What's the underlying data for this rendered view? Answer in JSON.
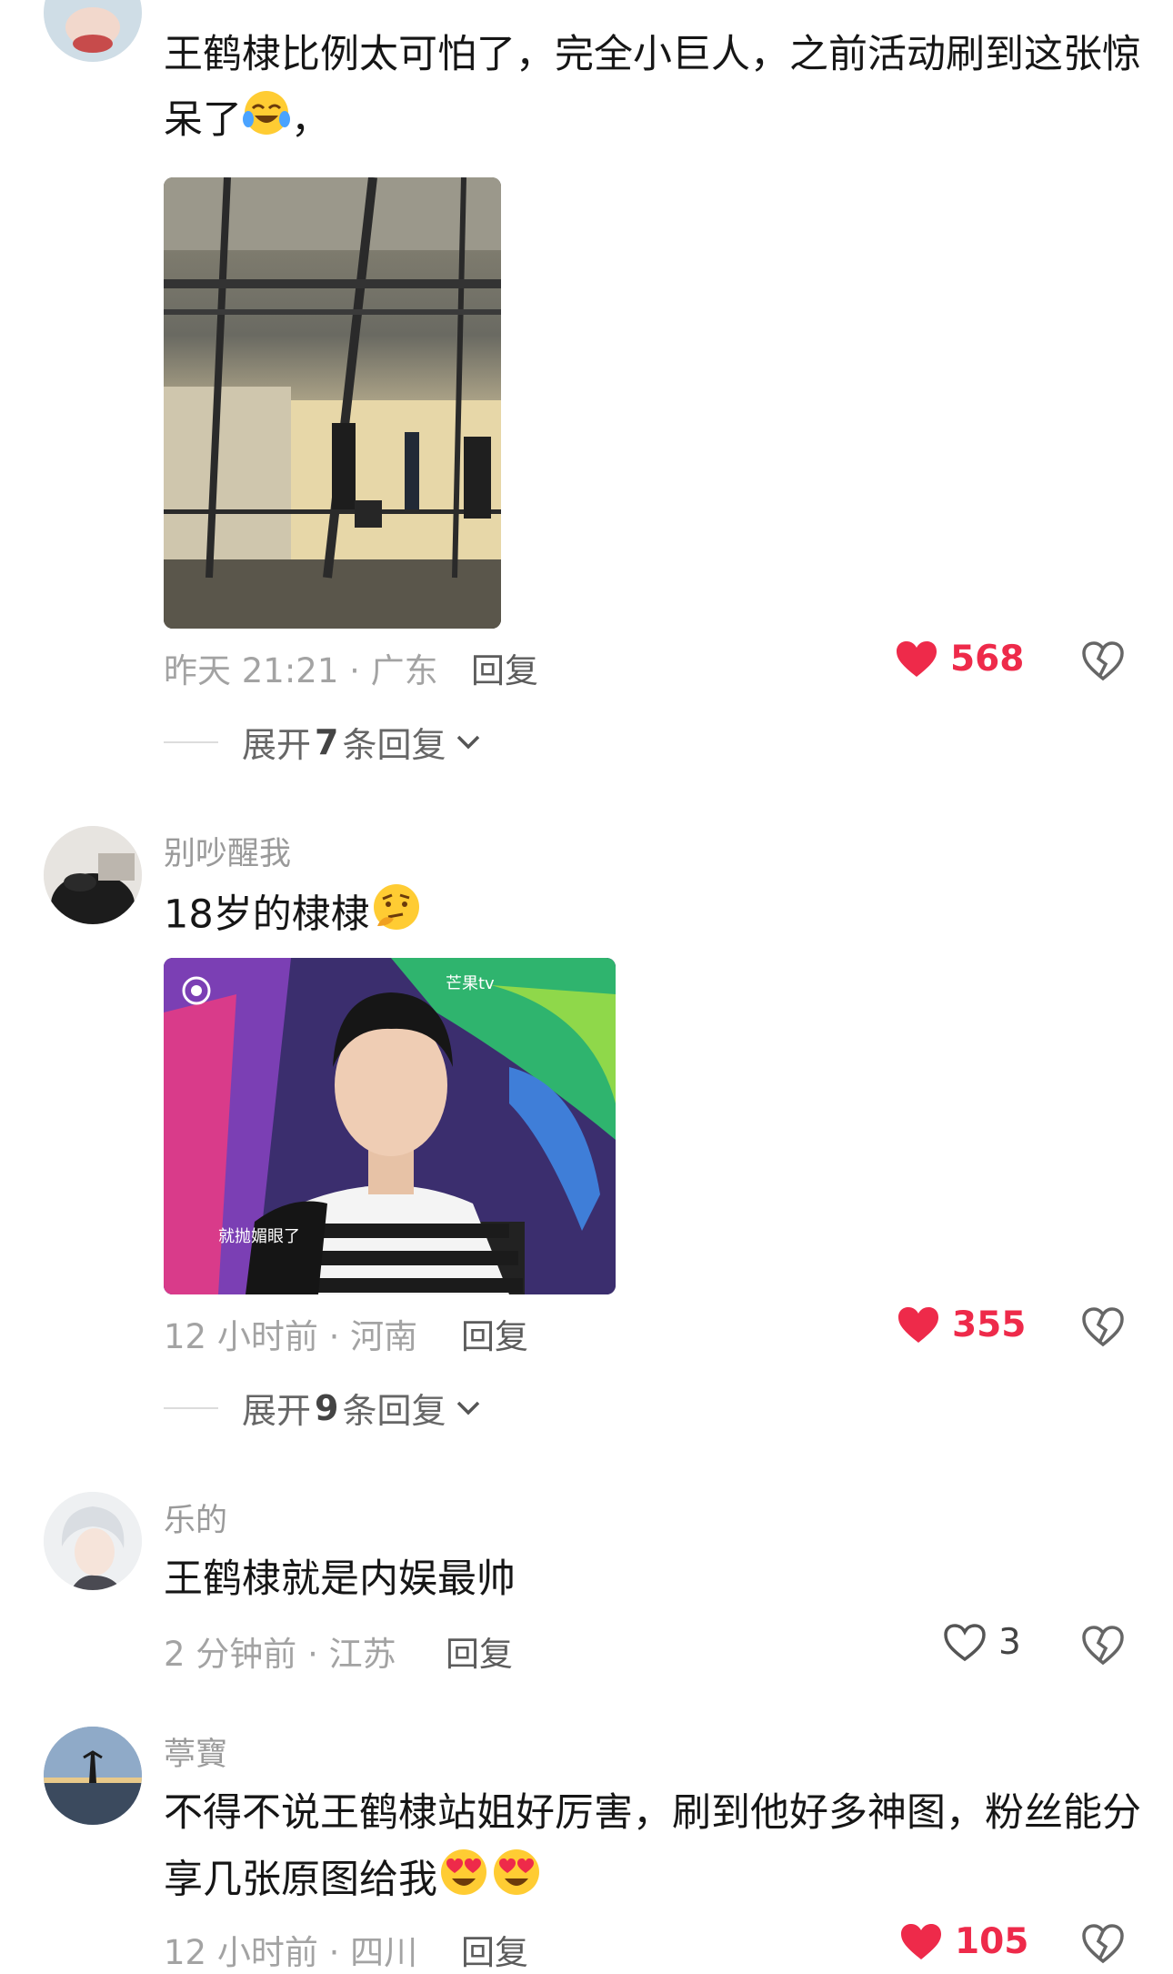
{
  "comments": [
    {
      "text": "王鹤棣比例太可怕了，完全小巨人，之前活动刷到这张惊呆了",
      "text_suffix": "，",
      "time_loc": "昨天 21:21 · 广东",
      "reply": "回复",
      "likes": "568",
      "liked": true,
      "expand": {
        "prefix": "展开",
        "count": "7",
        "suffix": "条回复"
      }
    },
    {
      "username": "别吵醒我",
      "text": "18岁的棣棣",
      "time_loc": "12 小时前 · 河南",
      "reply": "回复",
      "likes": "355",
      "liked": true,
      "photo_caption": "就抛媚眼了",
      "photo_watermark": "芒果tv",
      "expand": {
        "prefix": "展开",
        "count": "9",
        "suffix": "条回复"
      }
    },
    {
      "username": "乐的",
      "text": "王鹤棣就是内娱最帅",
      "time_loc": "2 分钟前 · 江苏",
      "reply": "回复",
      "likes": "3",
      "liked": false
    },
    {
      "username": "葶寶",
      "text": "不得不说王鹤棣站姐好厉害，刷到他好多神图，粉丝能分享几张原图给我",
      "time_loc": "12 小时前 · 四川",
      "reply": "回复",
      "likes": "105",
      "liked": true
    }
  ],
  "colors": {
    "like_red": "#ee2a4a",
    "meta_gray": "#a3a3a3"
  },
  "icons": [
    "heart-filled-icon",
    "heart-outline-icon",
    "broken-heart-icon",
    "chevron-down-icon",
    "crying-laughing-emoji",
    "thinking-emoji",
    "heart-eyes-emoji"
  ]
}
